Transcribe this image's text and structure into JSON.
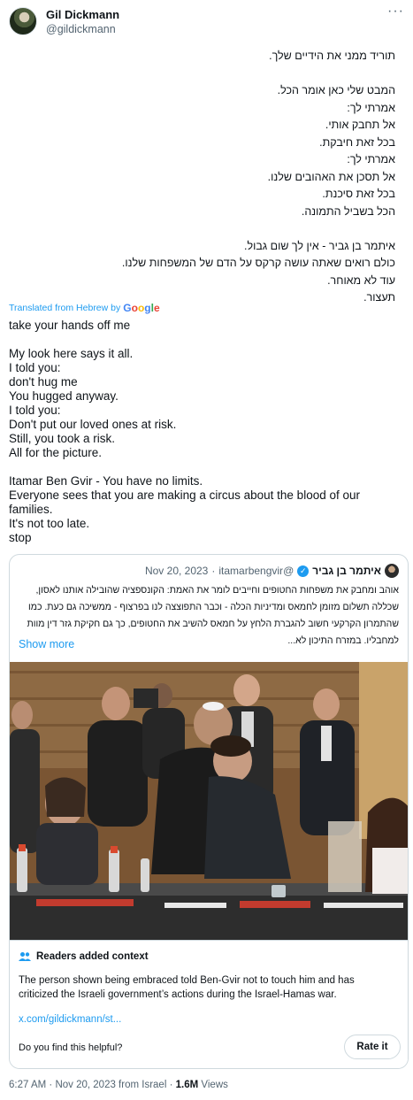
{
  "author": {
    "name": "Gil Dickmann",
    "handle": "@gildickmann"
  },
  "menu_icon": "more-horizontal-icon",
  "tweet": {
    "hebrew_lines": [
      "תוריד ממני את הידיים שלך.",
      "",
      "המבט שלי כאן אומר הכל.",
      "אמרתי לך:",
      "אל תחבק אותי.",
      "בכל זאת חיבקת.",
      "אמרתי לך:",
      "אל תסכן את האהובים שלנו.",
      "בכל זאת סיכנת.",
      "הכל בשביל התמונה.",
      "",
      "איתמר בן גביר - אין לך שום גבול.",
      "כולם רואים שאתה עושה קרקס על הדם של המשפחות שלנו.",
      "עוד לא מאוחר.",
      "תעצור."
    ],
    "translated_label": "Translated from Hebrew by",
    "translator": "Google",
    "english_lines": [
      "take your hands off me",
      "",
      "My look here says it all.",
      "I told you:",
      "don't hug me",
      "You hugged anyway.",
      "I told you:",
      "Don't put our loved ones at risk.",
      "Still, you took a risk.",
      "All for the picture.",
      "",
      "Itamar Ben Gvir - You have no limits.",
      "Everyone sees that you are making a circus about the blood of our families.",
      "It's not too late.",
      "stop"
    ]
  },
  "quoted": {
    "name": "איתמר בן גביר",
    "handle": "@itamarbengvir",
    "separator": "·",
    "date": "Nov 20, 2023",
    "text": "אוהב ומחבק את משפחות החטופים וחייבים לומר את האמת: הקונספציה שהובילה אותנו לאסון, שכללה תשלום מזומן לחמאס ומדיניות הכלה - וכבר התפוצצה לנו בפרצוף - ממשיכה גם כעת. כמו שהתמרון הקרקעי חשוב להגברת הלחץ על חמאס להשיב את החטופים, כך גם חקיקת גזר דין מוות למחבליו. במזרח התיכון לא...",
    "show_more": "Show more"
  },
  "community_note": {
    "title": "Readers added context",
    "text": "The person shown being embraced told Ben-Gvir not to touch him and has criticized the Israeli government’s actions during the Israel-Hamas war.",
    "link": "x.com/gildickmann/st...",
    "question": "Do you find this helpful?",
    "rate_label": "Rate it"
  },
  "footer": {
    "time": "6:27 AM",
    "dot": "·",
    "date": "Nov 20, 2023 from Israel",
    "views_count": "1.6M",
    "views_label": "Views"
  },
  "colors": {
    "accent": "#1d9bf0",
    "text": "#0f1419",
    "secondary": "#536471",
    "border": "#cfd9de"
  }
}
